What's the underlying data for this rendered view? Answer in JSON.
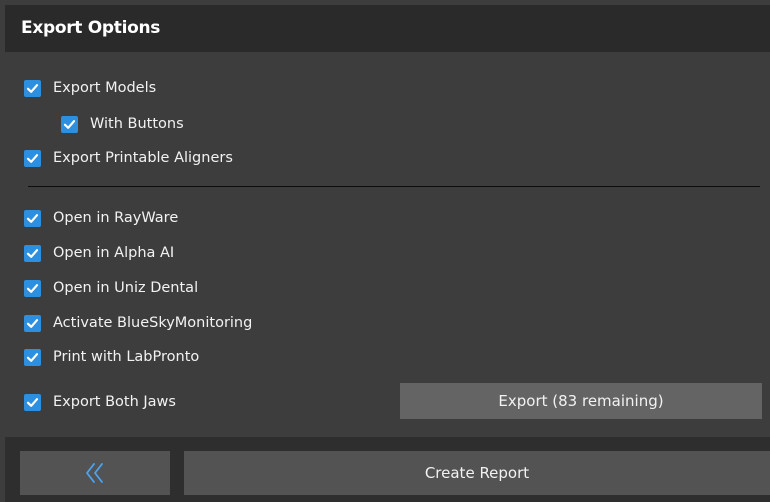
{
  "header": {
    "title": "Export Options"
  },
  "options": {
    "export_models": {
      "label": "Export Models",
      "checked": true
    },
    "with_buttons": {
      "label": "With Buttons",
      "checked": true
    },
    "export_printable_aligners": {
      "label": "Export Printable Aligners",
      "checked": true
    },
    "open_in_rayware": {
      "label": "Open in RayWare",
      "checked": true
    },
    "open_in_alpha_ai": {
      "label": "Open in Alpha AI",
      "checked": true
    },
    "open_in_uniz_dental": {
      "label": "Open in Uniz Dental",
      "checked": true
    },
    "activate_bluesky": {
      "label": "Activate BlueSkyMonitoring",
      "checked": true
    },
    "print_with_labpronto": {
      "label": "Print with LabPronto",
      "checked": true
    },
    "export_both_jaws": {
      "label": "Export Both Jaws",
      "checked": true
    }
  },
  "actions": {
    "export_label": "Export (83 remaining)",
    "create_report_label": "Create Report",
    "back_icon": "double-chevron-left-icon"
  },
  "colors": {
    "checkbox": "#2d8fe0",
    "panel_bg": "#3d3d3d",
    "header_bg": "#2a2a2a",
    "button_bg": "#646464",
    "footer_button_bg": "#535353",
    "back_icon": "#4da3f0"
  }
}
